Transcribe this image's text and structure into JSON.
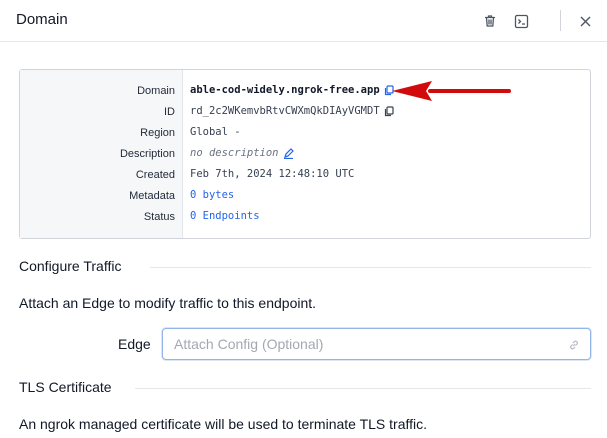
{
  "header": {
    "title": "Domain"
  },
  "details": {
    "labels": {
      "domain": "Domain",
      "id": "ID",
      "region": "Region",
      "description": "Description",
      "created": "Created",
      "metadata": "Metadata",
      "status": "Status"
    },
    "values": {
      "domain": "able-cod-widely.ngrok-free.app",
      "id": "rd_2c2WKemvbRtvCWXmQkDIAyVGMDT",
      "region": "Global -",
      "description": "no description",
      "created": "Feb 7th, 2024 12:48:10 UTC",
      "metadata": "0 bytes",
      "status": "0 Endpoints"
    }
  },
  "configure": {
    "title": "Configure Traffic",
    "text": "Attach an Edge to modify traffic to this endpoint.",
    "edge_label": "Edge",
    "edge_placeholder": "Attach Config (Optional)"
  },
  "tls": {
    "title": "TLS Certificate",
    "text": "An ngrok managed certificate will be used to terminate TLS traffic."
  },
  "colors": {
    "link": "#2563eb",
    "annotation_arrow": "#d10b0b",
    "input_border": "#93b4e8"
  },
  "icons": [
    "trash-icon",
    "terminal-icon",
    "close-icon",
    "copy-icon",
    "edit-icon",
    "link-icon"
  ]
}
